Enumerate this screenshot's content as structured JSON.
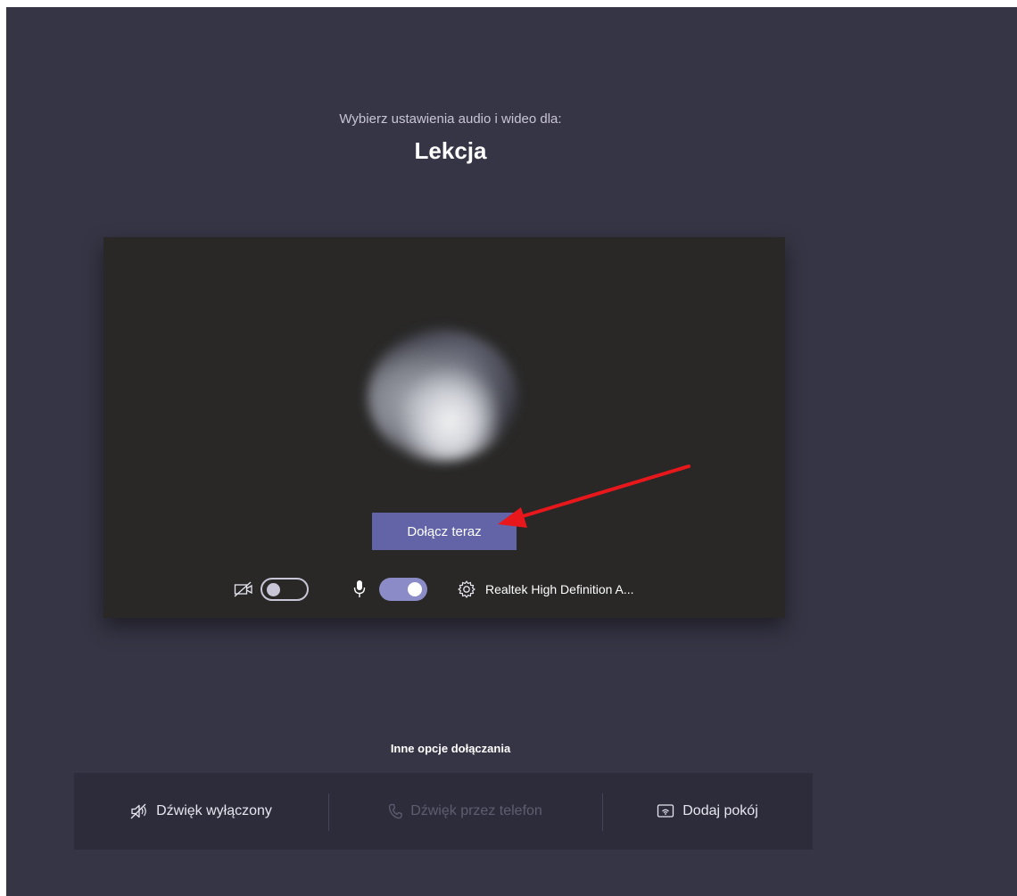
{
  "header": {
    "subtitle": "Wybierz ustawienia audio i wideo dla:",
    "meeting_title": "Lekcja"
  },
  "preview": {
    "join_button_label": "Dołącz teraz",
    "camera_toggle_on": false,
    "mic_toggle_on": true,
    "audio_device_label": "Realtek High Definition A..."
  },
  "other_options": {
    "title": "Inne opcje dołączania",
    "items": [
      {
        "label": "Dźwięk wyłączony",
        "icon": "speaker-off-icon",
        "enabled": true
      },
      {
        "label": "Dźwięk przez telefon",
        "icon": "phone-icon",
        "enabled": false
      },
      {
        "label": "Dodaj pokój",
        "icon": "room-cast-icon",
        "enabled": true
      }
    ]
  },
  "colors": {
    "background": "#363545",
    "preview_background": "#292827",
    "accent": "#6264a7",
    "toggle_on": "#8b8cc7",
    "annotation_arrow": "#e8171b"
  }
}
